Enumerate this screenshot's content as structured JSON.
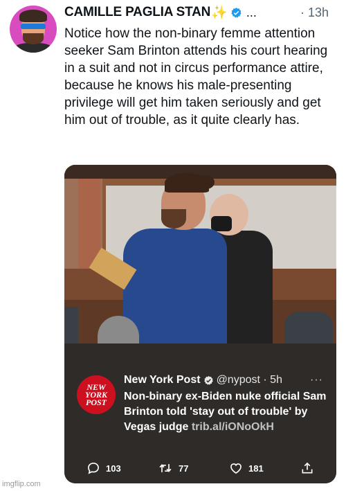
{
  "tweet": {
    "display_name": "CAMILLE PAGLIA STAN",
    "name_emoji": "✨",
    "more_label": "...",
    "time": "· 13h",
    "text": "Notice how the non-binary femme attention seeker Sam Brinton attends his court hearing in a suit and not in circus performance attire, because he knows his male-presenting privilege will get him taken seriously and get him out of trouble, as it quite clearly has."
  },
  "quoted": {
    "logo_lines": [
      "NEW",
      "YORK",
      "POST"
    ],
    "name": "New York Post",
    "handle": "@nypost · 5h",
    "more": "···",
    "text": "Non-binary ex-Biden nuke official Sam Brinton told 'stay out of trouble' by Vegas judge",
    "link": "trib.al/iONoOkH"
  },
  "actions": {
    "replies": "103",
    "retweets": "77",
    "likes": "181"
  },
  "watermark": "imgflip.com",
  "colors": {
    "verified_blue": "#1d9bf0",
    "nypost_red": "#cc1020",
    "card_dark": "#2f2b28"
  }
}
